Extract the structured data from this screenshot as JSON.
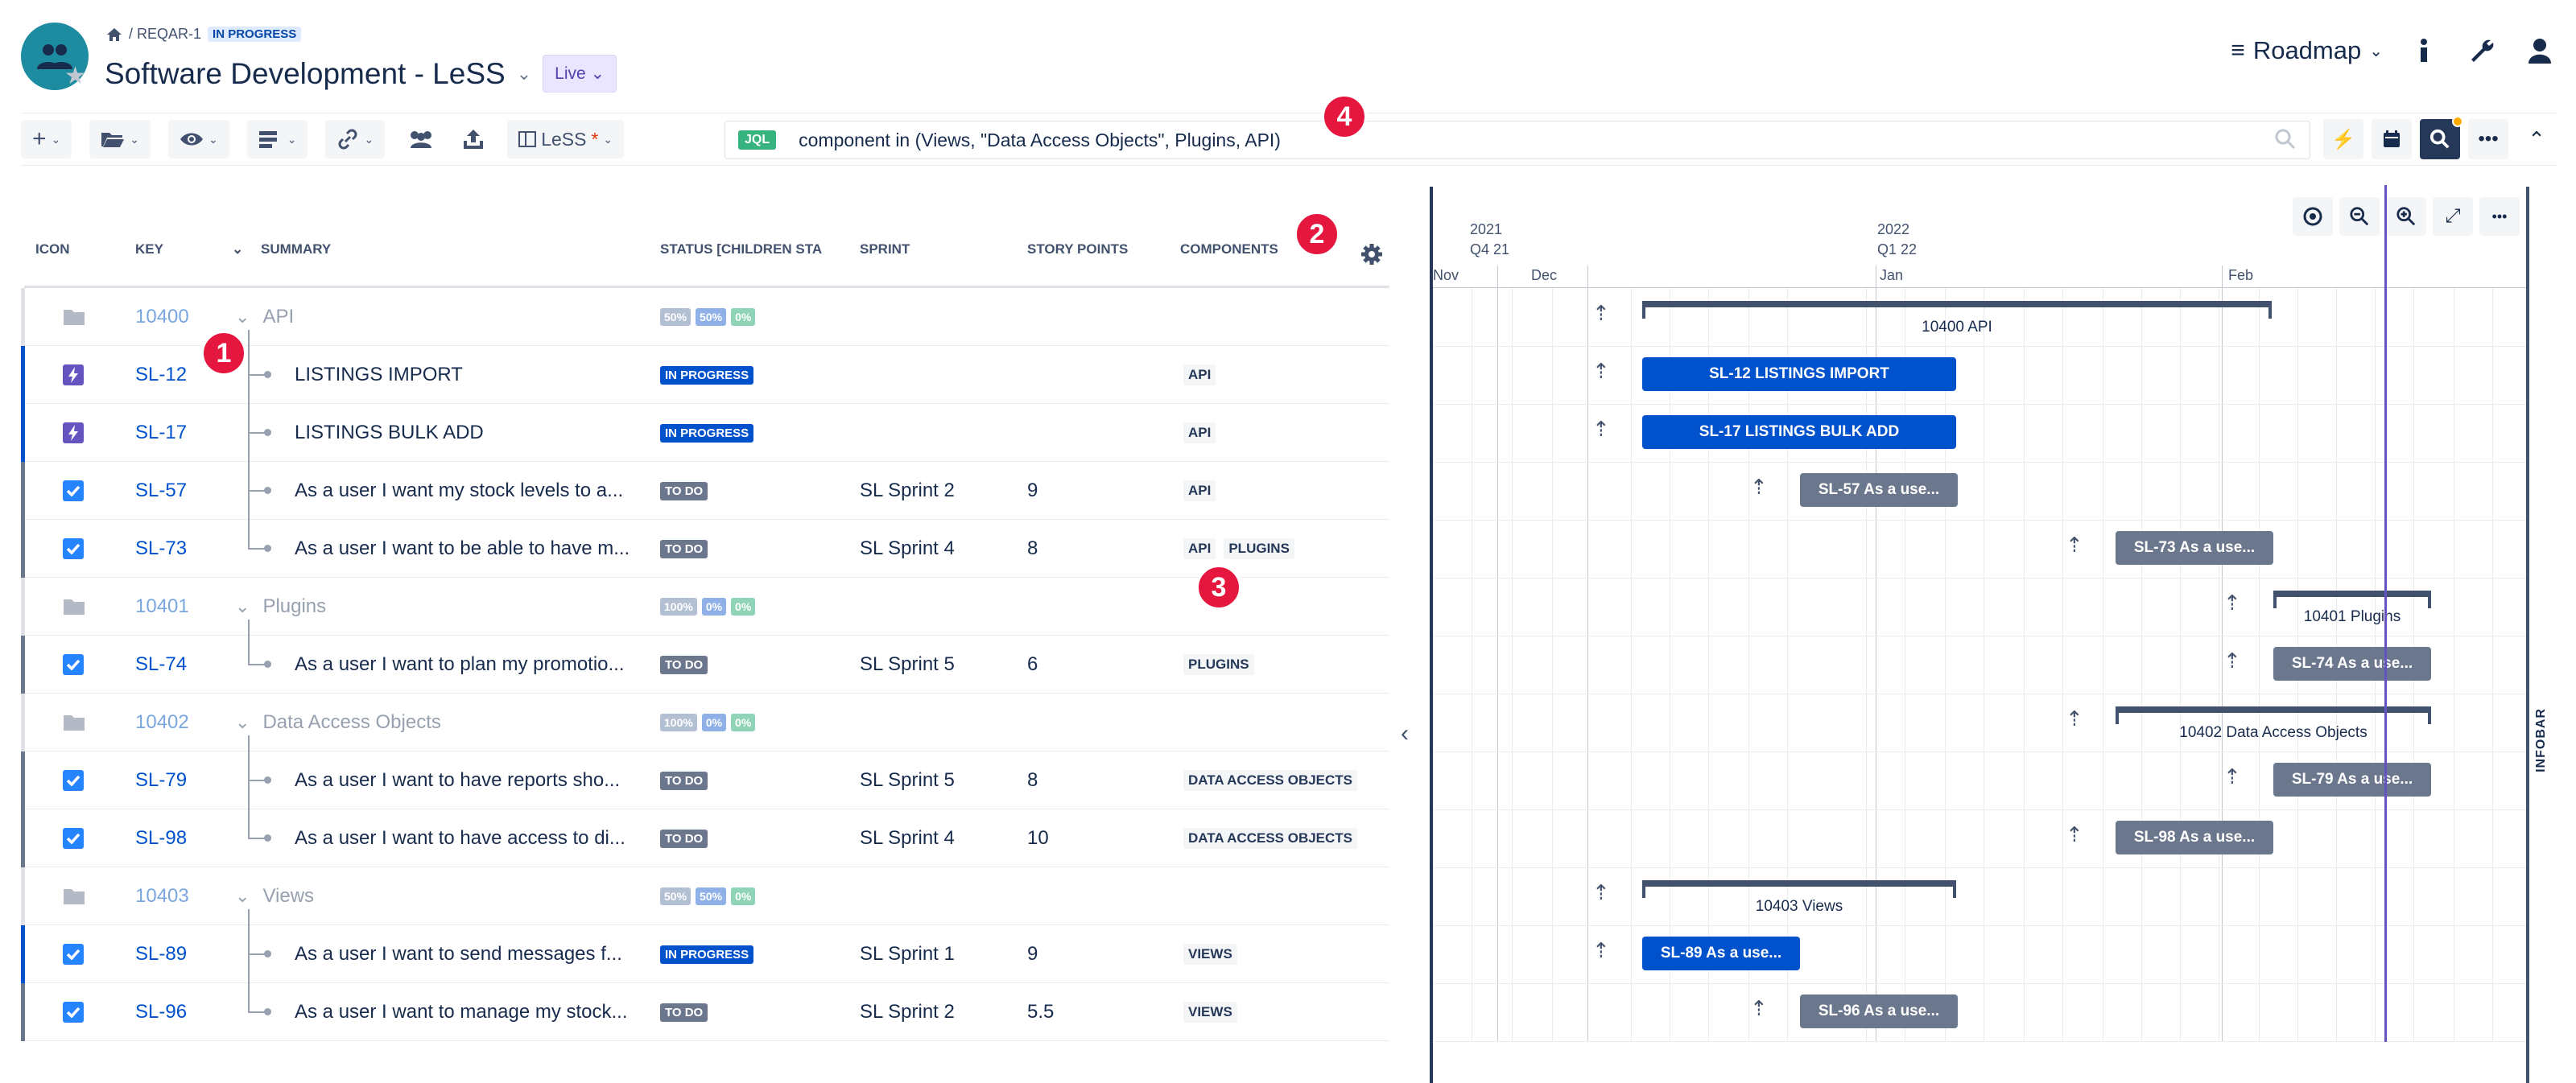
{
  "breadcrumb": {
    "path": "/ REQAR-1",
    "status": "IN PROGRESS"
  },
  "project": {
    "name": "Software Development - LeSS",
    "mode": "Live"
  },
  "view": {
    "label": "Roadmap"
  },
  "toolbar": {
    "structure_label": "LeSS",
    "structure_mark": "*",
    "jql_tag": "JQL",
    "jql_query": "component in (Views, \"Data Access Objects\", Plugins, API)"
  },
  "columns": {
    "icon": "ICON",
    "key": "KEY",
    "summary": "SUMMARY",
    "status": "STATUS [CHILDREN STA",
    "sprint": "SPRINT",
    "points": "STORY POINTS",
    "components": "COMPONENTS"
  },
  "rows": [
    {
      "type": "folder",
      "key": "10400",
      "summary": "API",
      "pct": [
        "50%",
        "50%",
        "0%"
      ]
    },
    {
      "type": "story",
      "icon": "lightning",
      "key": "SL-12",
      "summary": "LISTINGS IMPORT",
      "status": "IN PROGRESS",
      "sprint": "",
      "points": "",
      "components": [
        "API"
      ]
    },
    {
      "type": "story",
      "icon": "lightning",
      "key": "SL-17",
      "summary": "LISTINGS BULK ADD",
      "status": "IN PROGRESS",
      "sprint": "",
      "points": "",
      "components": [
        "API"
      ]
    },
    {
      "type": "story",
      "icon": "check",
      "key": "SL-57",
      "summary": "As a user I want my stock levels to a...",
      "status": "TO DO",
      "sprint": "SL Sprint 2",
      "points": "9",
      "components": [
        "API"
      ]
    },
    {
      "type": "story",
      "icon": "check",
      "key": "SL-73",
      "summary": "As a user I want to be able to have m...",
      "status": "TO DO",
      "sprint": "SL Sprint 4",
      "points": "8",
      "components": [
        "API",
        "PLUGINS"
      ]
    },
    {
      "type": "folder",
      "key": "10401",
      "summary": "Plugins",
      "pct": [
        "100%",
        "0%",
        "0%"
      ]
    },
    {
      "type": "story",
      "icon": "check",
      "key": "SL-74",
      "summary": "As a user I want to plan my promotio...",
      "status": "TO DO",
      "sprint": "SL Sprint 5",
      "points": "6",
      "components": [
        "PLUGINS"
      ]
    },
    {
      "type": "folder",
      "key": "10402",
      "summary": "Data Access Objects",
      "pct": [
        "100%",
        "0%",
        "0%"
      ]
    },
    {
      "type": "story",
      "icon": "check",
      "key": "SL-79",
      "summary": "As a user I want to have reports sho...",
      "status": "TO DO",
      "sprint": "SL Sprint 5",
      "points": "8",
      "components": [
        "DATA ACCESS OBJECTS"
      ]
    },
    {
      "type": "story",
      "icon": "check",
      "key": "SL-98",
      "summary": "As a user I want to have access to di...",
      "status": "TO DO",
      "sprint": "SL Sprint 4",
      "points": "10",
      "components": [
        "DATA ACCESS OBJECTS"
      ]
    },
    {
      "type": "folder",
      "key": "10403",
      "summary": "Views",
      "pct": [
        "50%",
        "50%",
        "0%"
      ]
    },
    {
      "type": "story",
      "icon": "check",
      "key": "SL-89",
      "summary": "As a user I want to send messages f...",
      "status": "IN PROGRESS",
      "sprint": "SL Sprint 1",
      "points": "9",
      "components": [
        "VIEWS"
      ]
    },
    {
      "type": "story",
      "icon": "check",
      "key": "SL-96",
      "summary": "As a user I want to manage my stock...",
      "status": "TO DO",
      "sprint": "SL Sprint 2",
      "points": "5.5",
      "components": [
        "VIEWS"
      ]
    }
  ],
  "callouts": [
    "1",
    "2",
    "3",
    "4"
  ],
  "timeline": {
    "years": [
      "2021",
      "2022"
    ],
    "quarters": [
      "Q4 21",
      "Q1 22"
    ],
    "months": [
      "Nov",
      "Dec",
      "Jan",
      "Feb"
    ]
  },
  "gantt": [
    {
      "kind": "epic",
      "label": "10400  API"
    },
    {
      "kind": "bar",
      "color": "blue",
      "label": "SL-12  LISTINGS IMPORT"
    },
    {
      "kind": "bar",
      "color": "blue",
      "label": "SL-17  LISTINGS BULK ADD"
    },
    {
      "kind": "bar",
      "color": "gray",
      "label": "SL-57  As a use..."
    },
    {
      "kind": "bar",
      "color": "gray",
      "label": "SL-73  As a use..."
    },
    {
      "kind": "epic",
      "label": "10401  Plugins"
    },
    {
      "kind": "bar",
      "color": "gray",
      "label": "SL-74  As a use..."
    },
    {
      "kind": "epic",
      "label": "10402  Data Access Objects"
    },
    {
      "kind": "bar",
      "color": "gray",
      "label": "SL-79  As a use..."
    },
    {
      "kind": "bar",
      "color": "gray",
      "label": "SL-98  As a use..."
    },
    {
      "kind": "epic",
      "label": "10403  Views"
    },
    {
      "kind": "bar",
      "color": "blue",
      "label": "SL-89  As a use..."
    },
    {
      "kind": "bar",
      "color": "gray",
      "label": "SL-96  As a use..."
    }
  ],
  "infobar": "INFOBAR",
  "colors": {
    "accent_blue": "#0052cc",
    "todo_gray": "#6b778c",
    "callout_red": "#e5173f",
    "today_line": "#6554c0",
    "jql_green": "#36b37e"
  }
}
